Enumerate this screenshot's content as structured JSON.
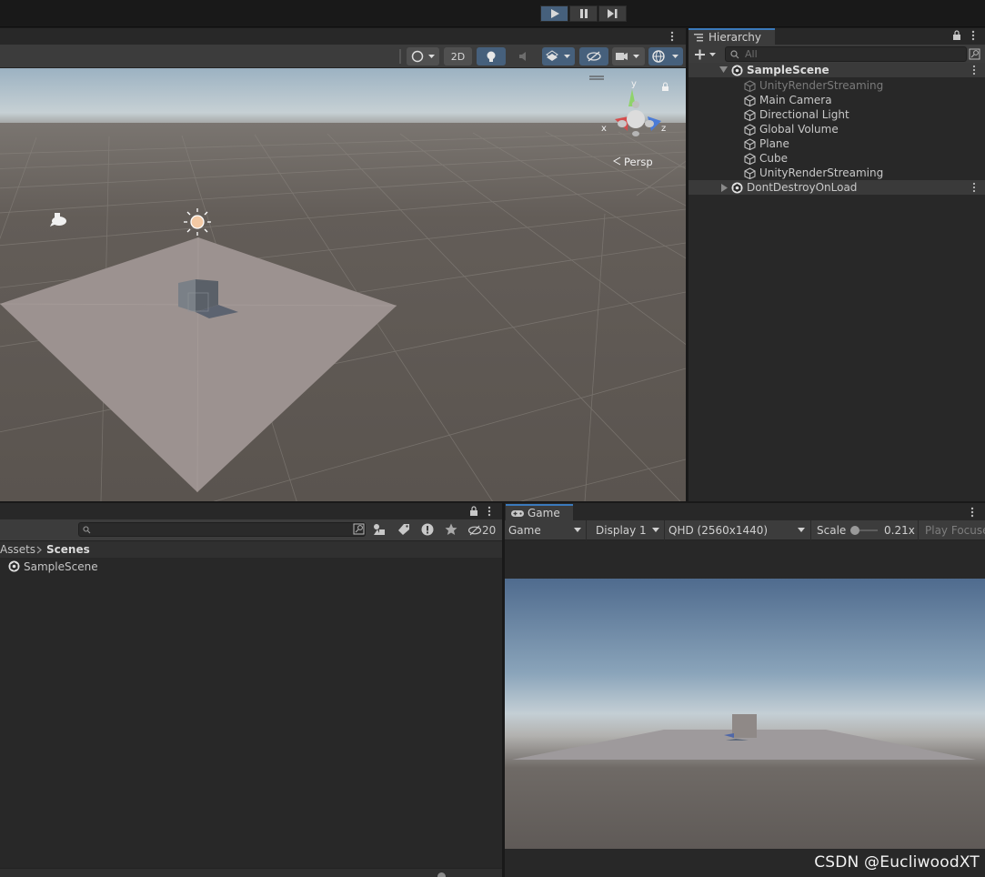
{
  "colors": {
    "accent": "#3a79bb",
    "panel": "#282828",
    "toolbar": "#3c3c3c",
    "selected_button": "#46607c",
    "scene_ground": "#5c5650",
    "plane": "#9c9290"
  },
  "scene_view": {
    "toolbar_2d_label": "2D",
    "persp_label": "Persp",
    "gizmo": {
      "x_label": "x",
      "y_label": "y",
      "z_label": "z"
    }
  },
  "hierarchy": {
    "tab_label": "Hierarchy",
    "search_placeholder": "All",
    "scene_name": "SampleScene",
    "items": [
      {
        "label": "UnityRenderStreaming",
        "disabled": true
      },
      {
        "label": "Main Camera"
      },
      {
        "label": "Directional Light"
      },
      {
        "label": "Global Volume"
      },
      {
        "label": "Plane"
      },
      {
        "label": "Cube"
      },
      {
        "label": "UnityRenderStreaming"
      }
    ],
    "dont_destroy": "DontDestroyOnLoad"
  },
  "project": {
    "hidden_count": "20",
    "breadcrumb": {
      "root": "Assets",
      "current": "Scenes"
    },
    "files": [
      {
        "label": "SampleScene"
      }
    ]
  },
  "game": {
    "tab_label": "Game",
    "mode": "Game",
    "display": "Display 1",
    "resolution": "QHD (2560x1440)",
    "scale_label": "Scale",
    "scale_value": "0.21x",
    "play_focus": "Play Focuse"
  },
  "watermark": "CSDN @EucliwoodXT"
}
